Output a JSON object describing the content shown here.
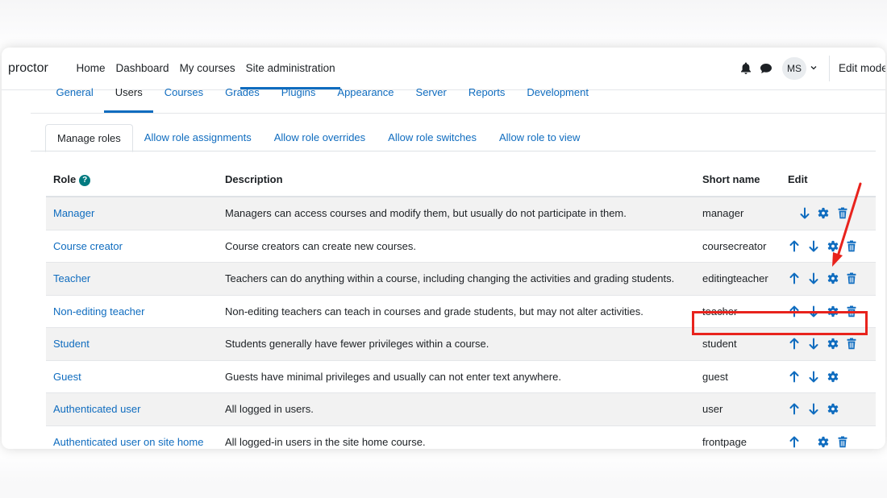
{
  "navbar": {
    "brand": "proctor",
    "items": [
      {
        "label": "Home"
      },
      {
        "label": "Dashboard"
      },
      {
        "label": "My courses"
      },
      {
        "label": "Site administration"
      }
    ],
    "avatar_initials": "MS",
    "edit_mode_label": "Edit mode",
    "icons": [
      "bell-icon",
      "chat-icon",
      "chevron-down-icon"
    ]
  },
  "admin_tabs": [
    {
      "label": "General"
    },
    {
      "label": "Users"
    },
    {
      "label": "Courses"
    },
    {
      "label": "Grades"
    },
    {
      "label": "Plugins"
    },
    {
      "label": "Appearance"
    },
    {
      "label": "Server"
    },
    {
      "label": "Reports"
    },
    {
      "label": "Development"
    }
  ],
  "role_tabs": [
    {
      "label": "Manage roles"
    },
    {
      "label": "Allow role assignments"
    },
    {
      "label": "Allow role overrides"
    },
    {
      "label": "Allow role switches"
    },
    {
      "label": "Allow role to view"
    }
  ],
  "table": {
    "headers": {
      "role": "Role",
      "description": "Description",
      "short_name": "Short name",
      "edit": "Edit"
    },
    "rows": [
      {
        "name": "Manager",
        "description": "Managers can access courses and modify them, but usually do not participate in them.",
        "short": "manager",
        "edit": [
          "down",
          "settings",
          "delete"
        ]
      },
      {
        "name": "Course creator",
        "description": "Course creators can create new courses.",
        "short": "coursecreator",
        "edit": [
          "up",
          "down",
          "settings",
          "delete"
        ]
      },
      {
        "name": "Teacher",
        "description": "Teachers can do anything within a course, including changing the activities and grading students.",
        "short": "editingteacher",
        "edit": [
          "up",
          "down",
          "settings",
          "delete"
        ]
      },
      {
        "name": "Non-editing teacher",
        "description": "Non-editing teachers can teach in courses and grade students, but may not alter activities.",
        "short": "teacher",
        "edit": [
          "up",
          "down",
          "settings",
          "delete"
        ]
      },
      {
        "name": "Student",
        "description": "Students generally have fewer privileges within a course.",
        "short": "student",
        "edit": [
          "up",
          "down",
          "settings",
          "delete"
        ]
      },
      {
        "name": "Guest",
        "description": "Guests have minimal privileges and usually can not enter text anywhere.",
        "short": "guest",
        "edit": [
          "up",
          "down",
          "settings"
        ]
      },
      {
        "name": "Authenticated user",
        "description": "All logged in users.",
        "short": "user",
        "edit": [
          "up",
          "down",
          "settings"
        ]
      },
      {
        "name": "Authenticated user on site home",
        "description": "All logged-in users in the site home course.",
        "short": "frontpage",
        "edit": [
          "up",
          "settings",
          "delete"
        ]
      }
    ]
  },
  "colors": {
    "link": "#0f6cbf",
    "icon": "#0f6cbf",
    "annotation": "#e8231d",
    "help": "#007a80"
  }
}
